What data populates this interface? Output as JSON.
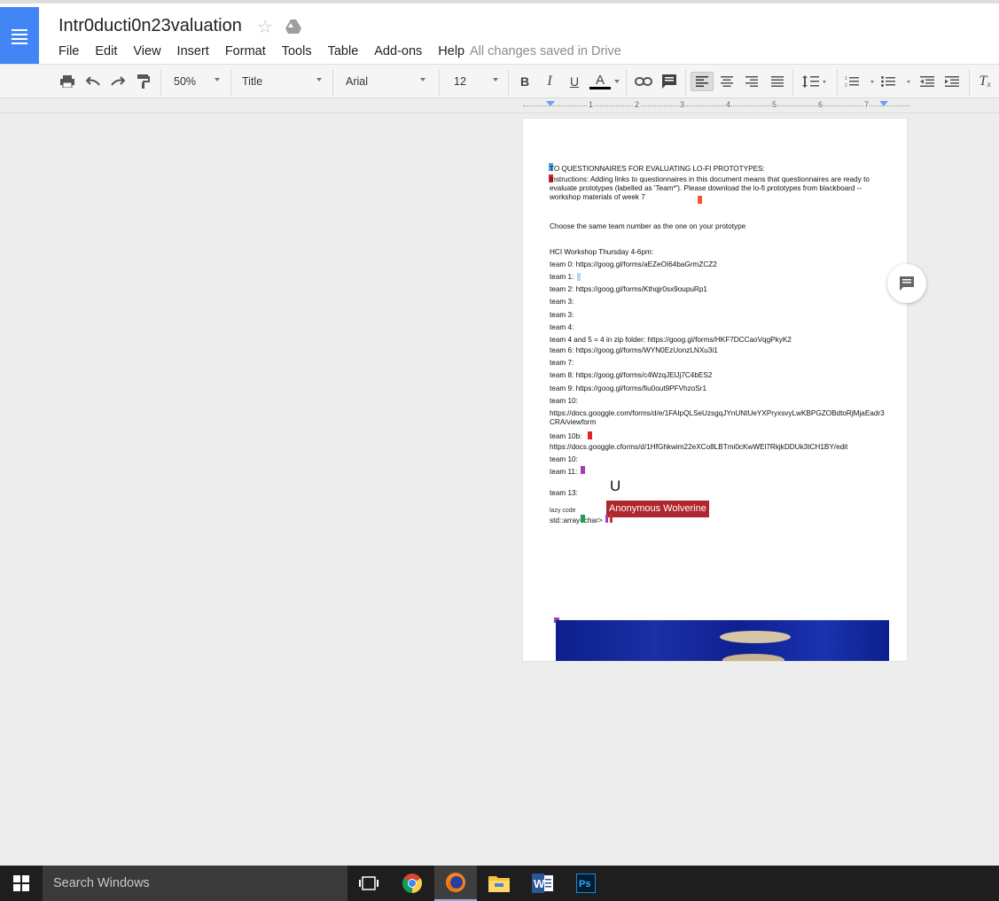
{
  "header": {
    "title": "Intr0ducti0n23valuation",
    "save_status": "All changes saved in Drive"
  },
  "menu": [
    "File",
    "Edit",
    "View",
    "Insert",
    "Format",
    "Tools",
    "Table",
    "Add-ons",
    "Help"
  ],
  "toolbar": {
    "zoom": "50%",
    "style": "Title",
    "font": "Arial",
    "font_size": "12",
    "bold": "B",
    "italic": "I",
    "underline": "U",
    "text_color": "A"
  },
  "ruler": [
    "1",
    "2",
    "3",
    "4",
    "5",
    "6",
    "7"
  ],
  "document": {
    "lines": [
      "TO QUESTIONNAIRES FOR EVALUATING LO-FI PROTOTYPES:",
      "Instructions: Adding links to questionnaires in this document means that questionnaires are ready to evaluate prototypes (labelled as 'Team*'). Please download the lo-fi prototypes from blackboard -- workshop materials of week 7",
      "Choose the same team  number as the one on your prototype",
      "HCI Workshop Thursday 4-6pm:",
      "team 0: https://goog.gl/forms/aEZeOI64baGrmZCZ2",
      "team 1:",
      "team 2: https://goog.gl/forms/Kthqjr0sx9oupuRp1",
      "team 3:",
      "team 3:",
      "team 4:",
      "team  4 and 5 = 4 in zip folder: https://goog.gl/forms/HKF7DCCaoVqgPkyK2",
      "team  6: https://goog.gl/forms/WYN0EzUonzLNXu3i1",
      "team  7:",
      "team  8: https://goog.gl/forms/c4WzqJElJj7C4bES2",
      "team  9: https://goog.gl/forms/fiu0out9PFVhzoSr1",
      "team  10:",
      "https://docs.googgle.com/forms/d/e/1FAIpQLSeUzsgqJYnUNtUeYXPryxsvyLwKBPGZOBdtoRjMjaEadr3CRA/viewform",
      "team  10b:",
      "https://docs.googgle.cforms/d/1HfGhkwim22eXCo8LBTmi0cKwWEl7RkjkDDUk3tCH1BY/edit",
      "team  10:",
      "team  11:",
      "team  13:",
      "lazy code",
      "std::array<char>"
    ],
    "big_char": "U",
    "collaborator": "Anonymous Wolverine"
  },
  "taskbar": {
    "search_placeholder": "Search Windows",
    "apps": [
      "task-view-icon",
      "chrome-icon",
      "firefox-icon",
      "file-explorer-icon",
      "word-icon",
      "photoshop-icon"
    ]
  },
  "colors": {
    "docs_blue": "#4285f4",
    "author_tag": "#b0262e",
    "taskbar": "#1e1e1e"
  }
}
